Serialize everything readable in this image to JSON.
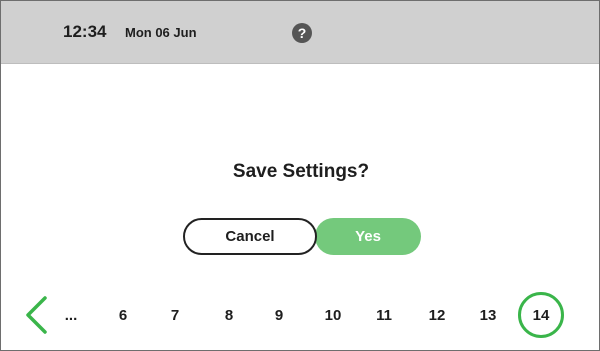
{
  "status_bar": {
    "time": "12:34",
    "date": "Mon 06 Jun",
    "help_icon": "help-icon",
    "help_glyph": "?"
  },
  "dialog": {
    "title": "Save Settings?",
    "cancel_label": "Cancel",
    "yes_label": "Yes"
  },
  "pagination": {
    "back_icon": "chevron-left-icon",
    "ellipsis": "...",
    "pages": [
      "6",
      "7",
      "8",
      "9",
      "10",
      "11",
      "12",
      "13"
    ],
    "current": "14"
  },
  "colors": {
    "status_bar_bg": "#d0d0d0",
    "accent_green": "#74c97c",
    "current_ring": "#3ab54a",
    "text": "#1e1e1e"
  }
}
